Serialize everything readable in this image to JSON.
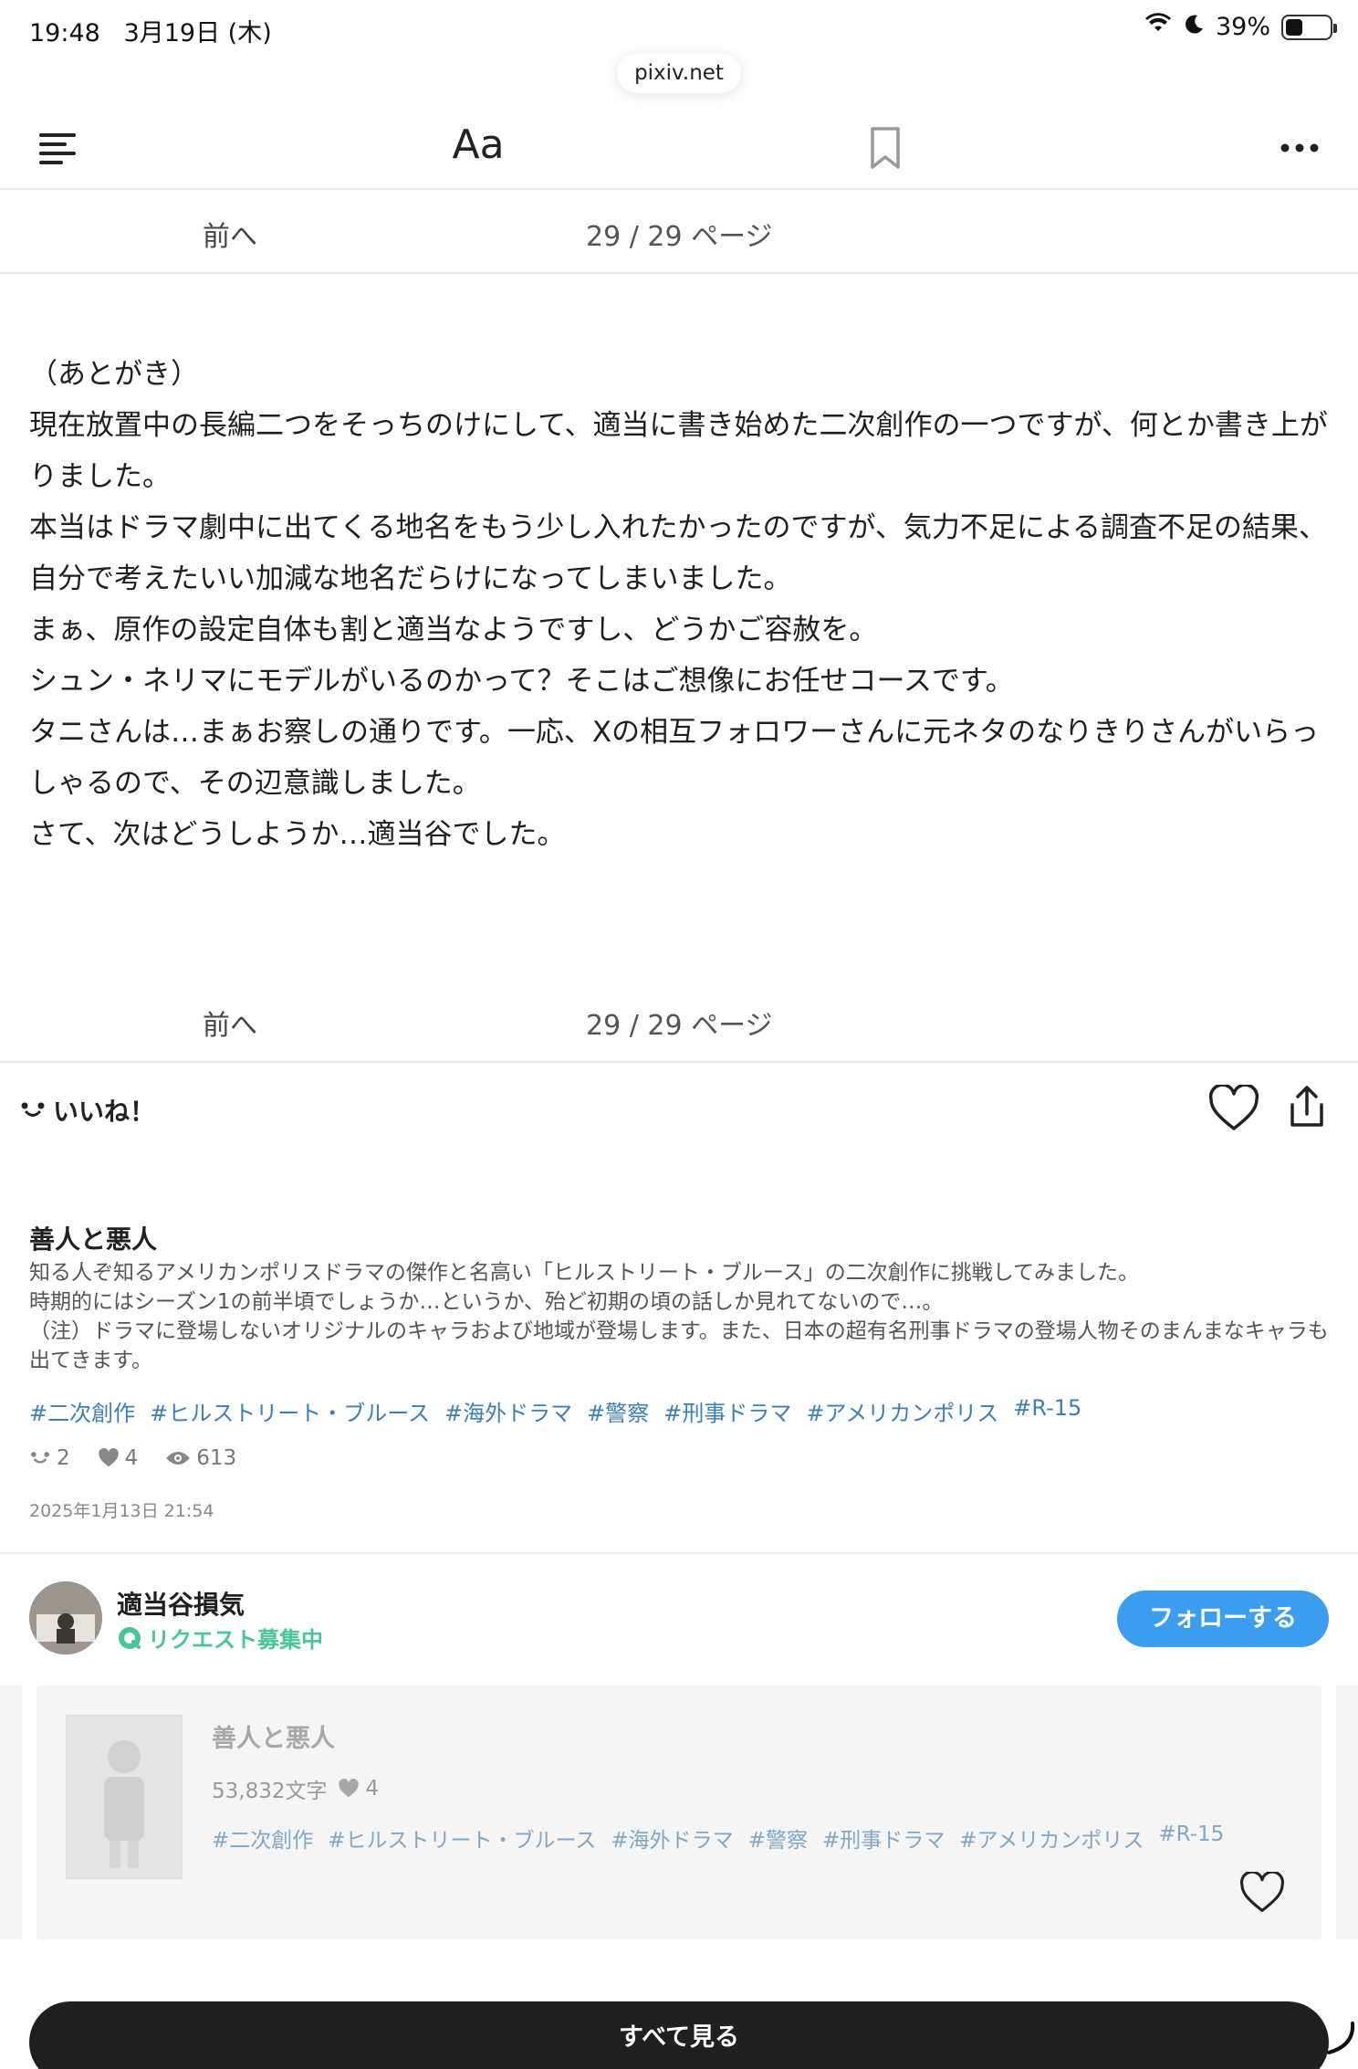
{
  "status_bar": {
    "time": "19:48",
    "date": "3月19日 (木)",
    "battery": "39%",
    "battery_level": 0.39
  },
  "browser": {
    "url": "pixiv.net"
  },
  "toolbar": {
    "font_label": "Aa"
  },
  "pager": {
    "prev_label": "前へ",
    "page_count": "29 / 29 ページ"
  },
  "afterword": {
    "lines": [
      "（あとがき）",
      "現在放置中の長編二つをそっちのけにして、適当に書き始めた二次創作の一つですが、何とか書き上がりました。",
      "本当はドラマ劇中に出てくる地名をもう少し入れたかったのですが、気力不足による調査不足の結果、自分で考えたいい加減な地名だらけになってしまいました。",
      "まぁ、原作の設定自体も割と適当なようですし、どうかご容赦を。",
      "シュン・ネリマにモデルがいるのかって？そこはご想像にお任せコースです。",
      "タニさんは…まぁお察しの通りです。一応、Xの相互フォロワーさんに元ネタのなりきりさんがいらっしゃるので、その辺意識しました。",
      "さて、次はどうしようか…適当谷でした。"
    ]
  },
  "like": {
    "label": "いいね！"
  },
  "work": {
    "title": "善人と悪人",
    "description": [
      "知る人ぞ知るアメリカンポリスドラマの傑作と名高い「ヒルストリート・ブルース」の二次創作に挑戦してみました。",
      "時期的にはシーズン1の前半頃でしょうか…というか、殆ど初期の頃の話しか見れてないので…。",
      "（注）ドラマに登場しないオリジナルのキャラおよび地域が登場します。また、日本の超有名刑事ドラマの登場人物そのまんまなキャラも出てきます。"
    ],
    "tags": [
      "#二次創作",
      "#ヒルストリート・ブルース",
      "#海外ドラマ",
      "#警察",
      "#刑事ドラマ",
      "#アメリカンポリス",
      "#R-15"
    ],
    "stats": {
      "likes": "2",
      "bookmarks": "4",
      "views": "613"
    },
    "date": "2025年1月13日 21:54"
  },
  "author": {
    "name": "適当谷損気",
    "request_label": "リクエスト募集中",
    "follow_label": "フォローする"
  },
  "card": {
    "title": "善人と悪人",
    "char_count": "53,832文字",
    "bookmarks": "4",
    "tags": [
      "#二次創作",
      "#ヒルストリート・ブルース",
      "#海外ドラマ",
      "#警察",
      "#刑事ドラマ",
      "#アメリカンポリス",
      "#R-15"
    ]
  },
  "see_all_label": "すべて見る",
  "colors": {
    "follow": "#3b9ef0",
    "tag": "#3d7fb8",
    "request": "#48c59a",
    "see_all_bg": "#1f1f1f"
  }
}
